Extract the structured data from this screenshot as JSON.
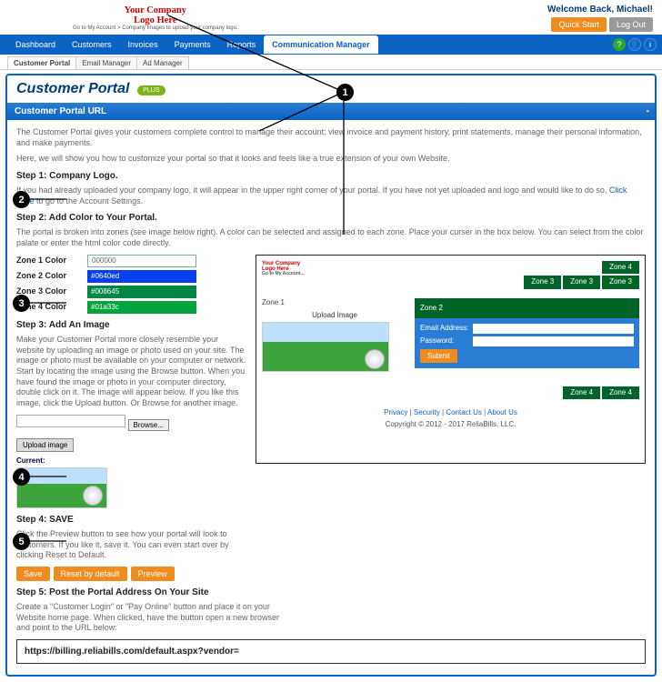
{
  "logo": {
    "main": "Your Company",
    "main2": "Logo Here",
    "sub": "Go to My Account > Company Images\nto upload your company logo."
  },
  "welcome": "Welcome Back, Michael!",
  "top_buttons": {
    "quick_start": "Quick Start",
    "logout": "Log Out"
  },
  "nav": [
    "Dashboard",
    "Customers",
    "Invoices",
    "Payments",
    "Reports",
    "Communication Manager"
  ],
  "subtabs": [
    "Customer Portal",
    "Email Manager",
    "Ad Manager"
  ],
  "page_heading": "Customer Portal",
  "badge": "PLUS",
  "section_header": "Customer Portal URL",
  "intro1": "The Customer Portal gives your customers complete control to manage their account: view invoice and payment history, print statements, manage their personal information, and make payments.",
  "intro2": "Here, we will show you how to customize your portal so that it looks and feels like a true extension of your own Website.",
  "step1_title": "Step 1: Company Logo.",
  "step1_text": "If you had already uploaded your company logo, it will appear in the upper right corner of your portal. If you have not yet uploaded and logo and would like to do so, ",
  "step1_link": "Click Here",
  "step1_text2": " to go to the Account Settings.",
  "step2_title": "Step 2: Add Color to Your Portal.",
  "step2_text": "The portal is broken into zones (see image below right). A color can be selected and assigned to each zone. Place your curser in the box below. You can select from the color palate or enter the html color code directly.",
  "color_rows": [
    {
      "label": "Zone 1 Color",
      "value": "000000",
      "type": "input"
    },
    {
      "label": "Zone 2 Color",
      "value": "#0640ed",
      "type": "swatch",
      "class": "blue"
    },
    {
      "label": "Zone 3 Color",
      "value": "#008645",
      "type": "swatch",
      "class": "green1"
    },
    {
      "label": "Zone 4 Color",
      "value": "#01a33c",
      "type": "swatch",
      "class": "green2"
    }
  ],
  "step3_title": "Step 3: Add An Image",
  "step3_text": "Make your Customer Portal more closely resemble your website by uploading an image or photo used on your site. The image or photo must be available on your computer or network. Start by locating the image using the Browse button. When you have found the image or photo in your computer directory, double click on it. The image will appear below. If you like this image, click the Upload button. Or Browse for another image.",
  "browse_label": "Browse...",
  "upload_label": "Upload image",
  "current_label": "Current:",
  "step4_title": "Step 4: SAVE",
  "step4_text": "Click the Preview button to see how your portal will look to customers. If you like it, save it. You can even start over by clicking Reset to Default.",
  "actions": {
    "save": "Save",
    "reset": "Reset by default",
    "preview": "Preview"
  },
  "step5_title": "Step 5: Post the Portal Address On Your Site",
  "step5_text": "Create a \"Customer Login\" or \"Pay Online\" button and place it on your Website home page. When clicked, have the button open a new browser and point to the URL below:",
  "url": "https://billing.reliabills.com/default.aspx?vendor=",
  "preview": {
    "tabs_top": [
      "Zone 3",
      "Zone 3",
      "Zone 3"
    ],
    "zone4_top": "Zone 4",
    "zone1": "Zone 1",
    "upload": "Upload Image",
    "zone2": "Zone 2",
    "email": "Email Address:",
    "password": "Password:",
    "submit": "Submit",
    "tabs_bottom": [
      "Zone 4",
      "Zone 4"
    ],
    "footer_links": [
      "Privacy",
      "Security",
      "Contact Us",
      "About Us"
    ],
    "copyright": "Copyright © 2012 - 2017 ReliaBills, LLC."
  },
  "annotations": [
    "1",
    "2",
    "3",
    "4",
    "5"
  ]
}
